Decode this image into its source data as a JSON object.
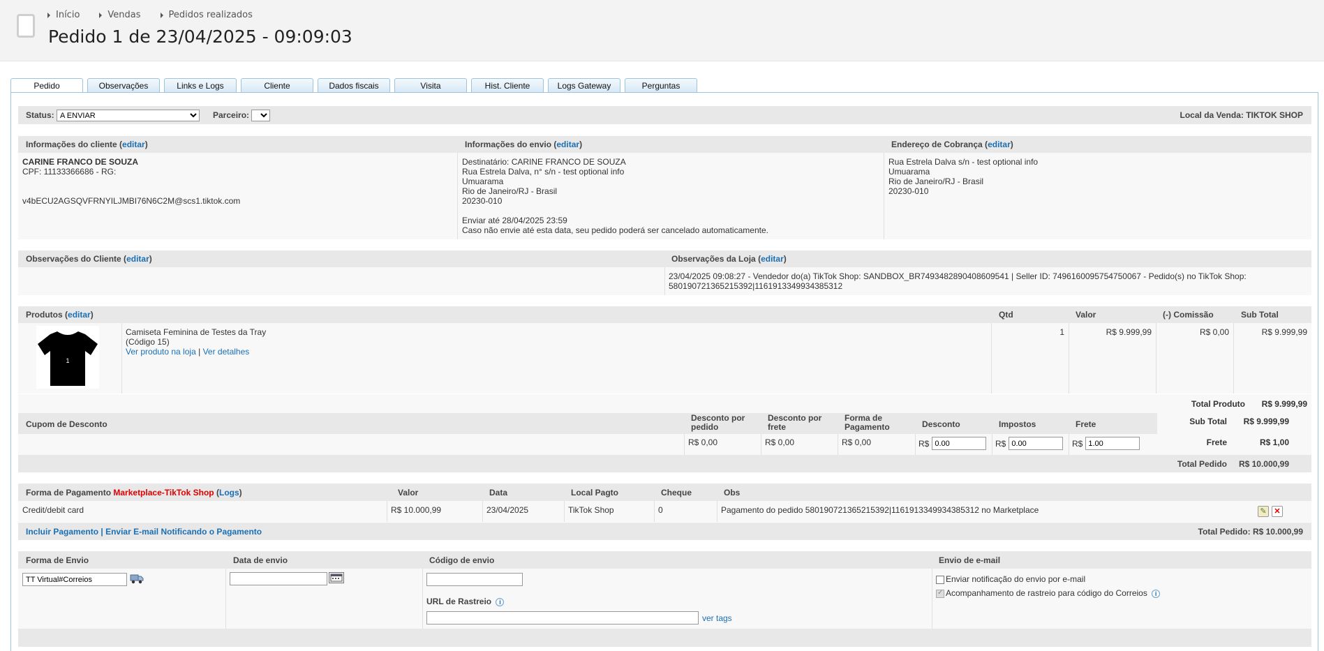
{
  "breadcrumbs": [
    "Início",
    "Vendas",
    "Pedidos realizados"
  ],
  "page_title": "Pedido 1 de 23/04/2025 - 09:09:03",
  "tabs": [
    "Pedido",
    "Observações",
    "Links e Logs",
    "Cliente",
    "Dados fiscais",
    "Visita",
    "Hist. Cliente",
    "Logs Gateway",
    "Perguntas"
  ],
  "status_bar": {
    "status_label": "Status:",
    "status_value": "A ENVIAR",
    "partner_label": "Parceiro:",
    "sale_location": "Local da Venda: TIKTOK SHOP"
  },
  "edit_label": "editar",
  "client_info": {
    "title": "Informações do cliente",
    "name": "CARINE FRANCO DE SOUZA",
    "doc": "CPF: 11133366686 - RG:",
    "email": "v4bECU2AGSQVFRNYILJMBI76N6C2M@scs1.tiktok.com"
  },
  "shipping_info": {
    "title": "Informações do envio",
    "lines": [
      "Destinatário: CARINE FRANCO DE SOUZA",
      "Rua Estrela Dalva, n° s/n - test optional info",
      "Umuarama",
      "Rio de Janeiro/RJ - Brasil",
      "20230-010"
    ],
    "deadline": "Enviar até 28/04/2025 23:59",
    "deadline_note": "Caso não envie até esta data, seu pedido poderá ser cancelado automaticamente."
  },
  "billing": {
    "title": "Endereço de Cobrança",
    "lines": [
      "Rua Estrela Dalva s/n - test optional info",
      "Umuarama",
      "Rio de Janeiro/RJ - Brasil",
      "20230-010"
    ]
  },
  "obs": {
    "client_title": "Observações do Cliente",
    "store_title": "Observações da Loja",
    "store_text_1": "23/04/2025 09:08:27 - Vendedor do(a) TikTok Shop: SANDBOX_BR7493482890408609541 | Seller ID: 7496160095754750067 - Pedido(s) no TikTok Shop:",
    "store_text_2": "580190721365215392|1161913349934385312"
  },
  "products": {
    "title": "Produtos",
    "headers": {
      "qtd": "Qtd",
      "valor": "Valor",
      "comissao": "(-) Comissão",
      "subtotal": "Sub Total"
    },
    "item": {
      "name": "Camiseta Feminina de Testes da Tray",
      "code": "(Código 15)",
      "link_store": "Ver produto na loja",
      "sep": "|",
      "link_details": "Ver detalhes",
      "image_label": "1",
      "qtd": "1",
      "valor": "R$ 9.999,99",
      "comissao": "R$ 0,00",
      "subtotal": "R$ 9.999,99"
    }
  },
  "totals": {
    "total_produto_label": "Total Produto",
    "total_produto": "R$ 9.999,99",
    "sub_total_label": "Sub Total",
    "sub_total": "R$ 9.999,99",
    "frete_label": "Frete",
    "frete": "R$ 1,00",
    "total_pedido_label": "Total Pedido",
    "total_pedido": "R$ 10.000,99"
  },
  "discount": {
    "title": "Cupom de Desconto",
    "h_pedido_1": "Desconto por",
    "h_pedido_2": "pedido",
    "h_frete_1": "Desconto por",
    "h_frete_2": "frete",
    "h_forma_1": "Forma de",
    "h_forma_2": "Pagamento",
    "h_desconto": "Desconto",
    "h_impostos": "Impostos",
    "h_frete": "Frete",
    "v_pedido": "R$ 0,00",
    "v_frete": "R$ 0,00",
    "v_forma": "R$ 0,00",
    "currency": "R$",
    "in_desconto": "0.00",
    "in_impostos": "0.00",
    "in_frete": "1.00"
  },
  "payment": {
    "title": "Forma de Pagamento",
    "method": "Marketplace-TikTok Shop",
    "logs": "Logs",
    "headers": {
      "valor": "Valor",
      "data": "Data",
      "local": "Local Pagto",
      "cheque": "Cheque",
      "obs": "Obs"
    },
    "row": {
      "forma": "Credit/debit card",
      "valor": "R$ 10.000,99",
      "data": "23/04/2025",
      "local": "TikTok Shop",
      "cheque": "0",
      "obs": "Pagamento do pedido 580190721365215392|1161913349934385312 no Marketplace"
    },
    "add_payment": "Incluir Pagamento",
    "sep": "|",
    "notify": "Enviar E-mail Notificando o Pagamento",
    "total": "Total Pedido: R$ 10.000,99"
  },
  "shipping_form": {
    "h_forma": "Forma de Envio",
    "h_data": "Data de envio",
    "h_codigo": "Código de envio",
    "h_email": "Envio de e-mail",
    "forma_value": "TT Virtual#Correios",
    "url_label": "URL de Rastreio",
    "ver_tags": "ver tags",
    "chk_notify": "Enviar notificação do envio por e-mail",
    "chk_tracking": "Acompanhamento de rastreio para código do Correios"
  }
}
